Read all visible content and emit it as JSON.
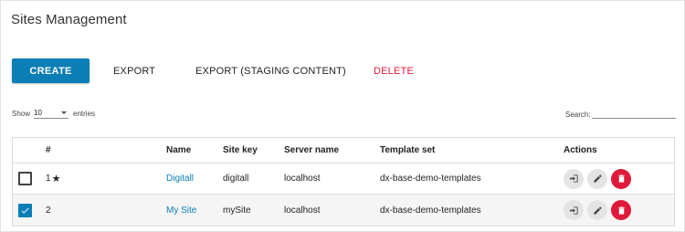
{
  "page": {
    "title": "Sites Management"
  },
  "toolbar": {
    "create_label": "CREATE",
    "export_label": "EXPORT",
    "export_staging_label": "EXPORT (STAGING CONTENT)",
    "delete_label": "DELETE"
  },
  "table_controls": {
    "show_label": "Show",
    "page_size": "10",
    "entries_label": "entries",
    "search_label": "Search:",
    "search_value": ""
  },
  "table": {
    "headers": {
      "num": "#",
      "name": "Name",
      "site_key": "Site key",
      "server_name": "Server name",
      "template_set": "Template set",
      "actions": "Actions"
    },
    "rows": [
      {
        "num": "1",
        "starred": true,
        "checked": false,
        "name": "Digitall",
        "site_key": "digitall",
        "server_name": "localhost",
        "template_set": "dx-base-demo-templates"
      },
      {
        "num": "2",
        "starred": false,
        "checked": true,
        "name": "My Site",
        "site_key": "mySite",
        "server_name": "localhost",
        "template_set": "dx-base-demo-templates"
      }
    ]
  },
  "icons": {
    "star": "star-icon",
    "check": "check-icon",
    "enter": "enter-site-icon",
    "edit": "pencil-icon",
    "delete": "trash-icon"
  },
  "colors": {
    "primary": "#0b7eb6",
    "danger": "#e0193a",
    "action_grey": "#e4e4e4"
  }
}
